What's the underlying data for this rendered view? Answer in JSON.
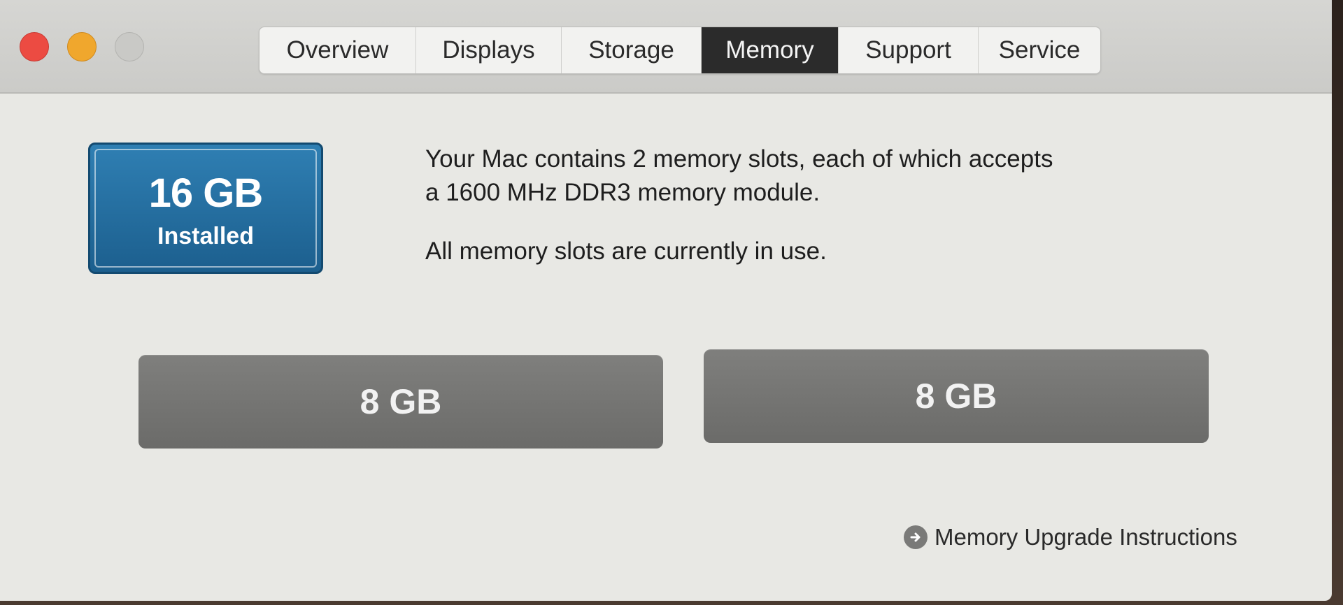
{
  "window": {
    "traffic_lights": {
      "close": "#ec4b42",
      "minimize": "#f0a72d",
      "zoom": "#c9c9c6"
    }
  },
  "tabs": [
    {
      "label": "Overview",
      "active": false
    },
    {
      "label": "Displays",
      "active": false
    },
    {
      "label": "Storage",
      "active": false
    },
    {
      "label": "Memory",
      "active": true
    },
    {
      "label": "Support",
      "active": false
    },
    {
      "label": "Service",
      "active": false
    }
  ],
  "memory": {
    "installed_size": "16 GB",
    "installed_label": "Installed",
    "description_line1": "Your Mac contains 2 memory slots, each of which accepts",
    "description_line2": "a 1600 MHz DDR3 memory module.",
    "status": "All memory slots are currently in use.",
    "slots": [
      {
        "size": "8 GB"
      },
      {
        "size": "8 GB"
      }
    ],
    "upgrade_link": "Memory Upgrade Instructions",
    "upgrade_icon": "arrow-circle-right-icon"
  },
  "colors": {
    "badge_blue": "#1c5f8e",
    "active_tab": "#2b2b2b",
    "slot_gray": "#6b6b69"
  }
}
